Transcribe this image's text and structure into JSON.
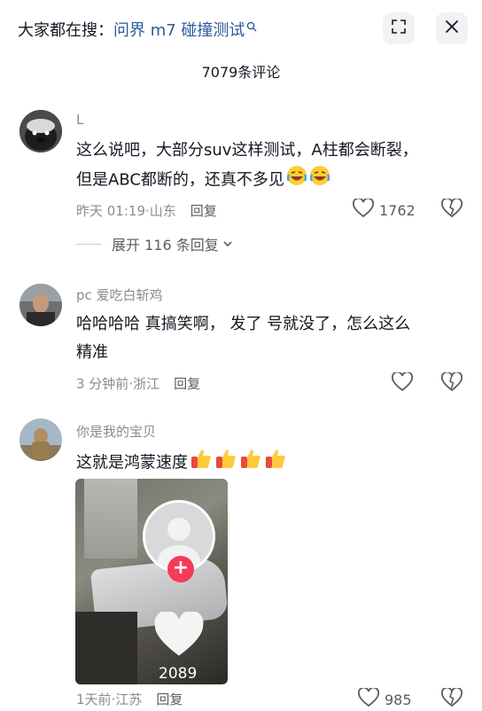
{
  "header": {
    "search_prefix": "大家都在搜：",
    "search_query": "问界 m7 碰撞测试",
    "search_icon": "search-icon",
    "expand_icon": "expand-icon",
    "close_icon": "close-icon"
  },
  "comment_count_title": "7079条评论",
  "comments": [
    {
      "user": "L",
      "text_lines": [
        "这么说吧，大部分suv这样测试，A柱都会断裂，",
        "但是ABC都断的，还真不多见"
      ],
      "emojis": [
        "laugh-cry-emoji",
        "laugh-cry-emoji"
      ],
      "time": "昨天 01:19",
      "location": "山东",
      "reply_label": "回复",
      "likes": "1762",
      "expand_label": "展开 116 条回复"
    },
    {
      "user": "pc 爱吃白斩鸡",
      "text_lines": [
        "哈哈哈哈 真搞笑啊， 发了 号就没了，怎么这么",
        "精准"
      ],
      "time": "3 分钟前",
      "location": "浙江",
      "reply_label": "回复",
      "likes": ""
    },
    {
      "user": "你是我的宝贝",
      "text_lines": [
        "这就是鸿蒙速度"
      ],
      "emojis": [
        "thumbs-up-emoji",
        "thumbs-up-emoji",
        "thumbs-up-emoji",
        "thumbs-up-emoji"
      ],
      "time": "1天前",
      "location": "江苏",
      "reply_label": "回复",
      "likes": "985",
      "video": {
        "like_count": "2089"
      }
    }
  ]
}
